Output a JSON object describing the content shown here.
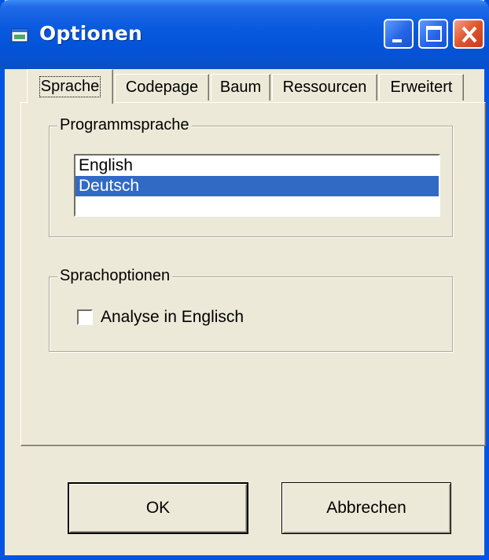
{
  "window": {
    "title": "Optionen",
    "colors": {
      "titlebar": "#0a5ae0",
      "face": "#ece9d8",
      "selection": "#316ac5",
      "close": "#e0532e"
    }
  },
  "tabs": [
    {
      "label": "Sprache",
      "active": true
    },
    {
      "label": "Codepage",
      "active": false
    },
    {
      "label": "Baum",
      "active": false
    },
    {
      "label": "Ressourcen",
      "active": false
    },
    {
      "label": "Erweitert",
      "active": false
    }
  ],
  "program_language": {
    "group_title": "Programmsprache",
    "items": [
      {
        "label": "English",
        "selected": false
      },
      {
        "label": "Deutsch",
        "selected": true
      }
    ]
  },
  "language_options": {
    "group_title": "Sprachoptionen",
    "checkbox_label": "Analyse in Englisch",
    "checked": false
  },
  "buttons": {
    "ok_label": "OK",
    "cancel_label": "Abbrechen"
  },
  "icons": {
    "app": "window-app-icon",
    "minimize": "minimize-icon",
    "maximize": "maximize-icon",
    "close": "close-icon"
  }
}
